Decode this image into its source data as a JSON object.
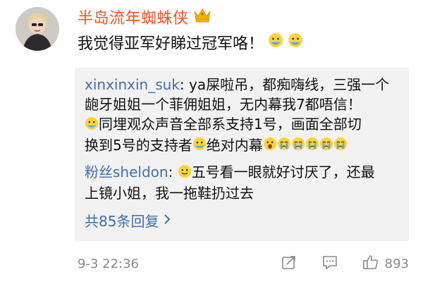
{
  "comment": {
    "username": "半岛流年蜘蛛侠",
    "text": "我觉得亚军好睇过冠军咯！",
    "timestamp": "9-3 22:36",
    "like_count": "893"
  },
  "replies": [
    {
      "author": "xinxinxin_suk",
      "separator": ": ",
      "line1": "ya屎啦吊，都痴嗨线，三强一个",
      "line2": "龅牙姐姐一个菲佣姐姐，无内幕我7都唔信！",
      "line3": "同埋观众声音全部系支持1号，画面全部切",
      "line4a": "换到5号的支持者",
      "line4b": "绝对内幕"
    },
    {
      "author": "粉丝sheldon",
      "separator": ": ",
      "line1": "五号看一眼就好讨厌了，还最",
      "line2": "上镜小姐，我一拖鞋扔过去"
    }
  ],
  "more_replies_label": "共85条回复",
  "icons": {
    "crown": "crown-icon",
    "share": "share-icon",
    "comment": "comment-icon",
    "like": "like-icon",
    "chevron": "chevron-right-icon"
  },
  "colors": {
    "username": "#e8562a",
    "link": "#436ea7",
    "reply_bg": "#f2f2f2",
    "meta": "#8a8a8a"
  }
}
